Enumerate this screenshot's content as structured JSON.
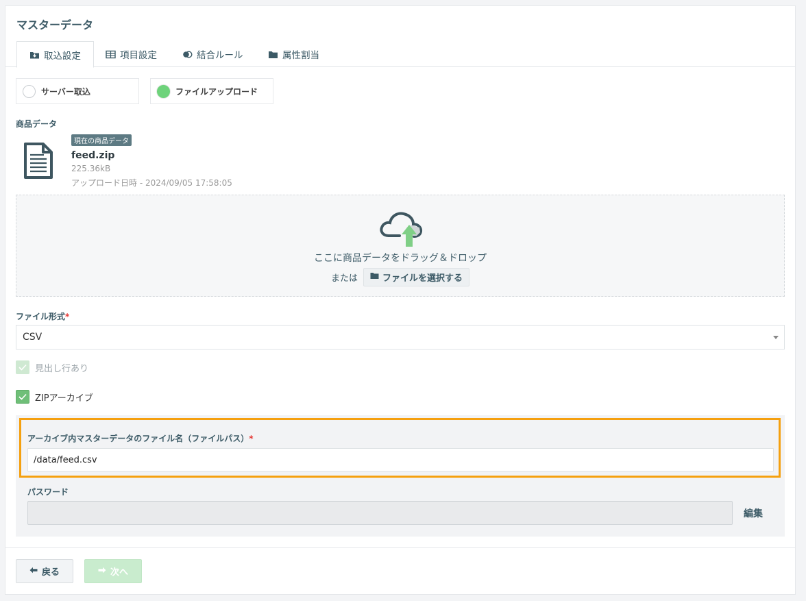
{
  "page": {
    "title": "マスターデータ"
  },
  "tabs": [
    {
      "label": "取込設定",
      "icon": "import-icon",
      "active": true
    },
    {
      "label": "項目設定",
      "icon": "table-icon",
      "active": false
    },
    {
      "label": "結合ルール",
      "icon": "merge-icon",
      "active": false
    },
    {
      "label": "属性割当",
      "icon": "folder-icon",
      "active": false
    }
  ],
  "source": {
    "server_label": "サーバー取込",
    "upload_label": "ファイルアップロード",
    "selected": "upload"
  },
  "product_data": {
    "label": "商品データ",
    "badge": "現在の商品データ",
    "file_name": "feed.zip",
    "file_size": "225.36kB",
    "upload_datetime": "アップロード日時 - 2024/09/05 17:58:05"
  },
  "dropzone": {
    "text": "ここに商品データをドラッグ＆ドロップ",
    "or_text": "または",
    "select_button": "ファイルを選択する"
  },
  "file_format": {
    "label": "ファイル形式",
    "required_mark": "*",
    "value": "CSV"
  },
  "header_row": {
    "label": "見出し行あり",
    "checked": true,
    "disabled": true
  },
  "zip_archive": {
    "label": "ZIPアーカイブ",
    "checked": true
  },
  "archive_path": {
    "label": "アーカイブ内マスターデータのファイル名（ファイルパス）",
    "required_mark": "*",
    "value": "/data/feed.csv"
  },
  "password": {
    "label": "パスワード",
    "value": "",
    "edit_label": "編集"
  },
  "footer": {
    "back_label": "戻る",
    "next_label": "次へ"
  },
  "colors": {
    "accent_text": "#3c5a66",
    "highlight": "#f5a00f",
    "success": "#6ed37b"
  }
}
